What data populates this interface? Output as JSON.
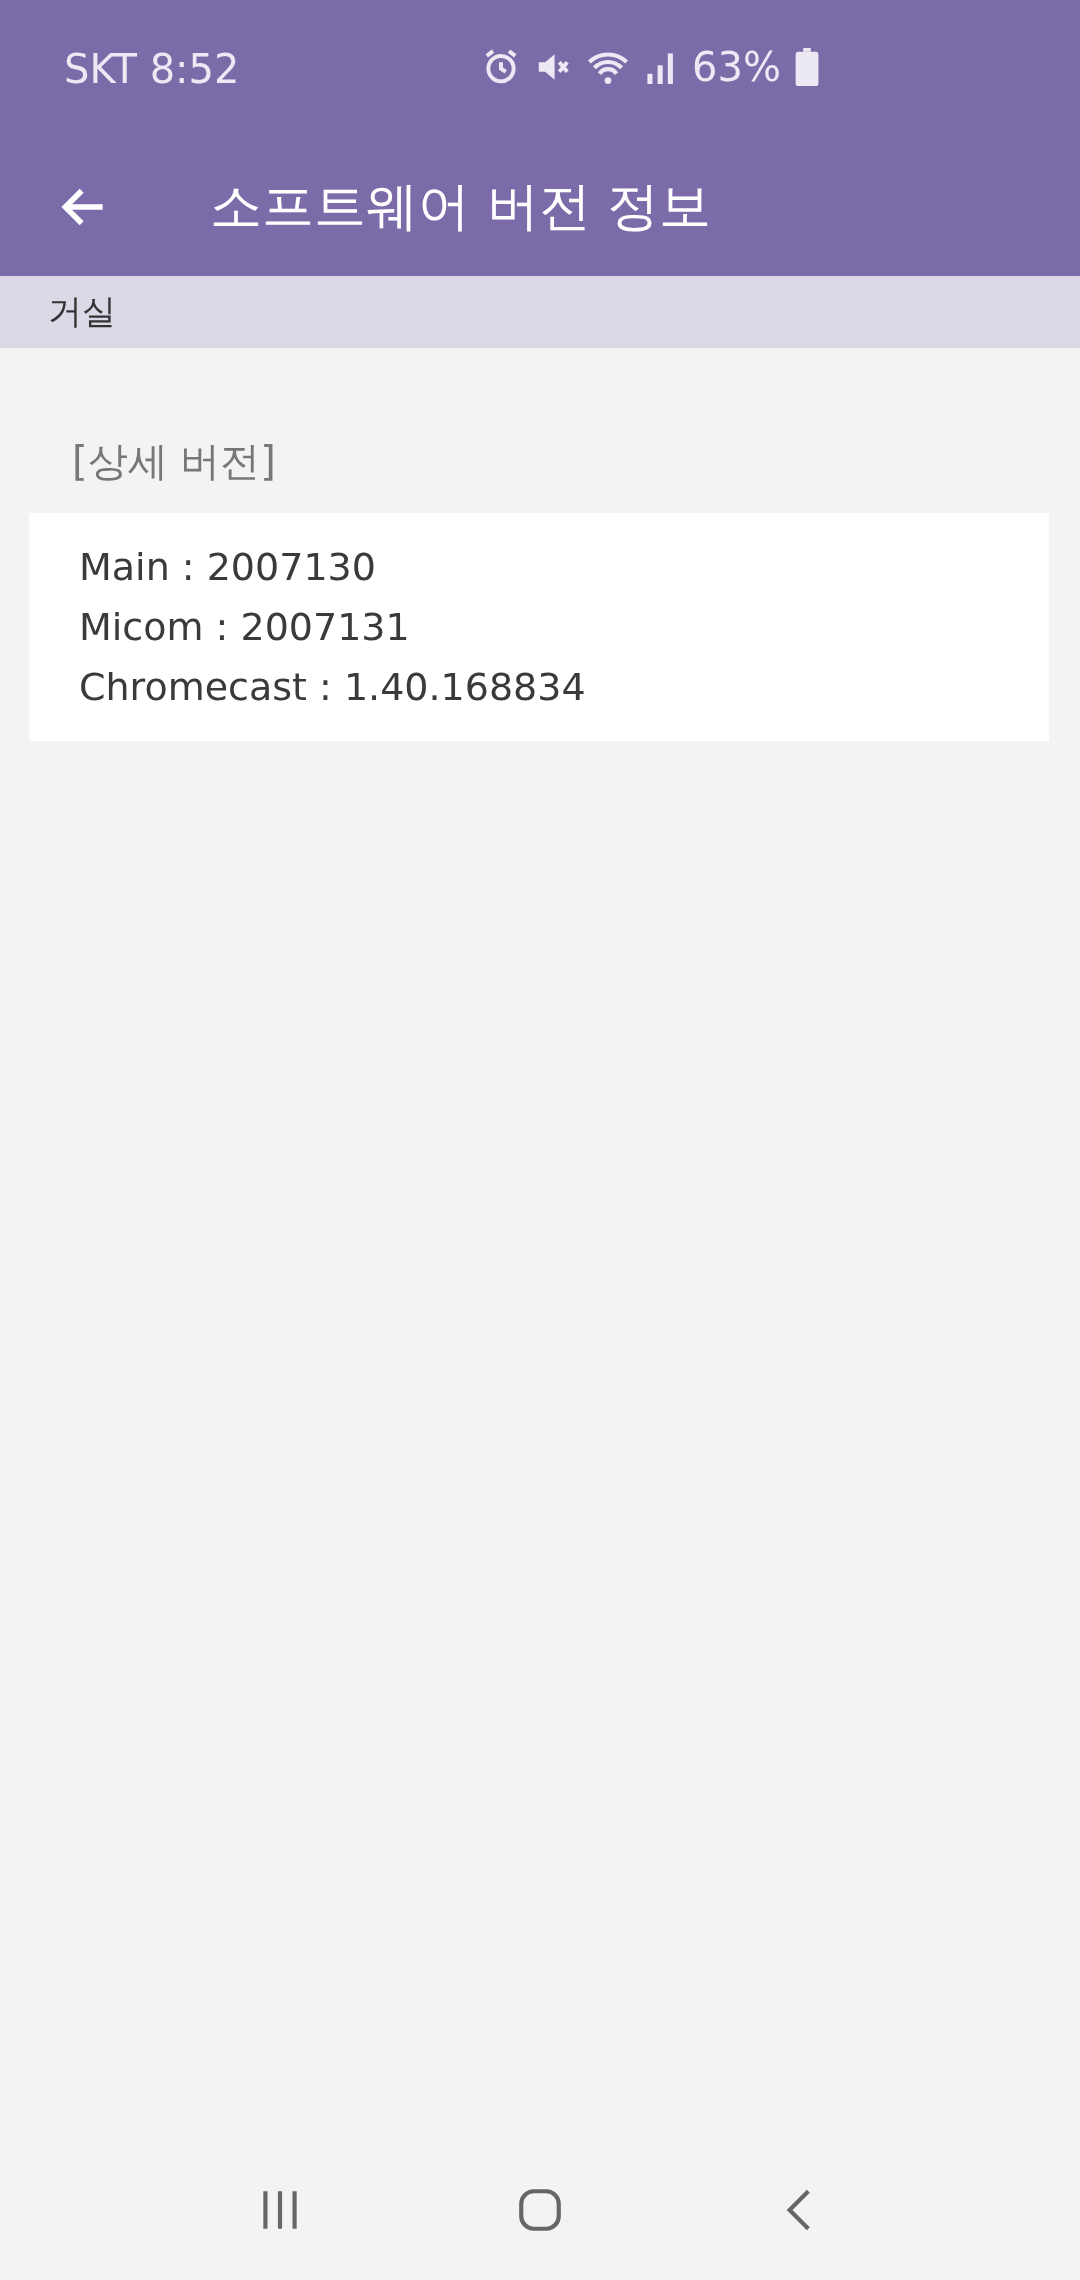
{
  "status_bar": {
    "carrier_time": "SKT 8:52",
    "battery": "63%"
  },
  "app_bar": {
    "title": "소프트웨어 버전 정보"
  },
  "subheader": {
    "room": "거실"
  },
  "section": {
    "title": "[상세 버전]",
    "lines": [
      "Main : 2007130",
      "Micom : 2007131",
      "Chromecast : 1.40.168834"
    ]
  }
}
